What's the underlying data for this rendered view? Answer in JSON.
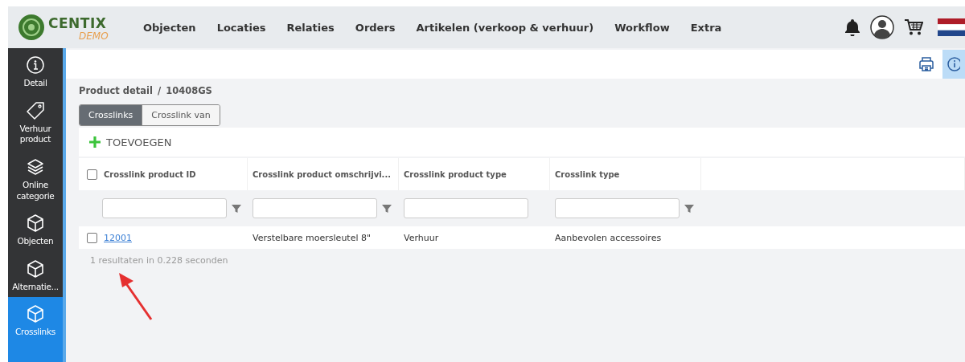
{
  "header": {
    "logo": {
      "name": "CENTIX",
      "tag": "DEMO"
    },
    "menu": [
      "Objecten",
      "Locaties",
      "Relaties",
      "Orders",
      "Artikelen (verkoop & verhuur)",
      "Workflow",
      "Extra"
    ]
  },
  "sidebar": {
    "items": [
      {
        "label": "Detail",
        "kind": "info",
        "selected": false
      },
      {
        "label": "Verhuur product",
        "kind": "tag",
        "selected": false
      },
      {
        "label": "Online categorie",
        "kind": "layers",
        "selected": false
      },
      {
        "label": "Objecten",
        "kind": "cube",
        "selected": false
      },
      {
        "label": "Alternatie...",
        "kind": "cube",
        "selected": false
      },
      {
        "label": "Crosslinks",
        "kind": "cube",
        "selected": true
      }
    ]
  },
  "breadcrumb": {
    "parent": "Product detail",
    "separator": "/",
    "current": "10408GS"
  },
  "tabs": [
    {
      "label": "Crosslinks",
      "selected": true
    },
    {
      "label": "Crosslink van",
      "selected": false
    }
  ],
  "add_button": {
    "label": "TOEVOEGEN"
  },
  "table": {
    "select_all": {
      "checked": false
    },
    "columns": [
      {
        "label": "Crosslink product ID",
        "filter_icon": true
      },
      {
        "label": "Crosslink product omschrijvi...",
        "filter_icon": true
      },
      {
        "label": "Crosslink product type",
        "filter_icon": false
      },
      {
        "label": "Crosslink type",
        "filter_icon": true
      }
    ],
    "rows": [
      {
        "checked": false,
        "cells": [
          "12001",
          "Verstelbare moersleutel 8\"",
          "Verhuur",
          "Aanbevolen accessoires"
        ]
      }
    ]
  },
  "result_summary": "1 resultaten in 0.228 seconden"
}
